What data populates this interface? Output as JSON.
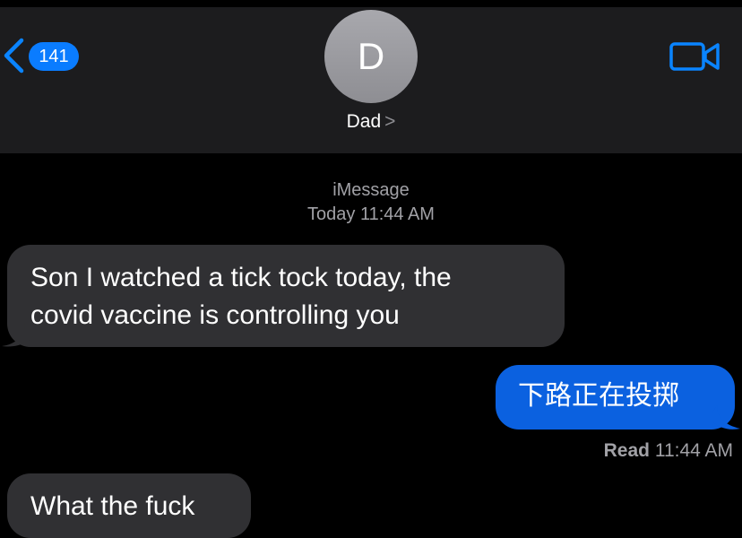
{
  "header": {
    "back_badge": "141",
    "avatar_initial": "D",
    "contact_name": "Dad",
    "contact_chevron": ">",
    "back_icon": "chevron-left-icon",
    "call_icon": "video-camera-icon"
  },
  "thread": {
    "service": "iMessage",
    "timestamp": "Today 11:44 AM",
    "messages": [
      {
        "direction": "incoming",
        "text_line1": "Son I watched a tick tock today, the",
        "text_line2": "covid vaccine is controlling you"
      },
      {
        "direction": "outgoing",
        "text": "下路正在投掷"
      },
      {
        "direction": "incoming",
        "text": "What the fuck"
      }
    ],
    "read_receipt": {
      "label": "Read",
      "time": "11:44 AM"
    }
  },
  "colors": {
    "header_bg": "#1c1c1e",
    "incoming_bubble": "#303033",
    "outgoing_bubble": "#0b61e0",
    "accent": "#0a7cff"
  }
}
